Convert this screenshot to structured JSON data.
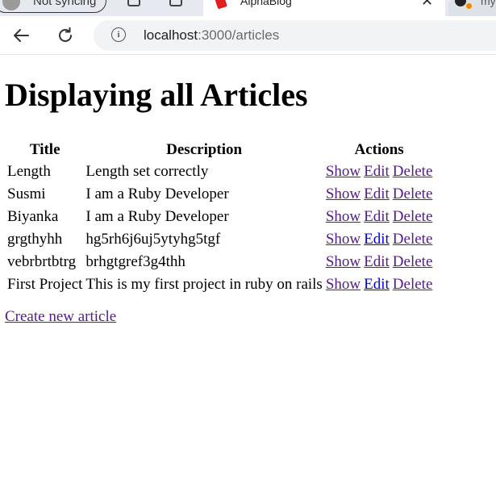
{
  "browser": {
    "profile_label": "Not syncing",
    "active_tab_title": "AlphaBlog",
    "next_tab_label": "my",
    "url_host": "localhost",
    "url_path": ":3000/articles"
  },
  "page": {
    "heading": "Displaying all Articles",
    "columns": [
      "Title",
      "Description",
      "Actions"
    ],
    "rows": [
      {
        "title": "Length",
        "description": "Length set correctly",
        "show": "Show",
        "edit": "Edit",
        "delete": "Delete"
      },
      {
        "title": "Susmi",
        "description": "I am a Ruby Developer",
        "show": "Show",
        "edit": "Edit",
        "delete": "Delete"
      },
      {
        "title": "Biyanka",
        "description": "I am a Ruby Developer",
        "show": "Show",
        "edit": "Edit",
        "delete": "Delete"
      },
      {
        "title": "grgthyhh",
        "description": "hg5rh6j6uj5ytyhg5tgf",
        "show": "Show",
        "edit": "Edit",
        "delete": "Delete"
      },
      {
        "title": "vebrbrtbtrg",
        "description": "brhgtgref3g4thh",
        "show": "Show",
        "edit": "Edit",
        "delete": "Delete"
      },
      {
        "title": "First Project",
        "description": "This is my first project in ruby on rails",
        "show": "Show",
        "edit": "Edit",
        "delete": "Delete"
      }
    ],
    "create_link": "Create new article"
  },
  "colors": {
    "visited_link": "#551a8b",
    "unvisited_link": "#0000ee"
  }
}
